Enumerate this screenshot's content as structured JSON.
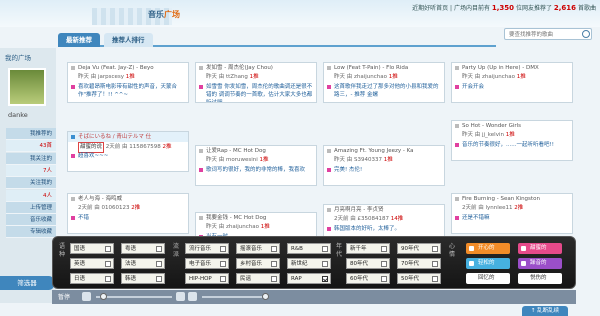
{
  "header": {
    "logo_main": "音乐",
    "logo_accent": "广场",
    "links": "近期好听首页 | 广场内目前有",
    "count_a": "1,350",
    "mid": "位网友推荐了",
    "count_b": "2,616",
    "tail": "首歌曲",
    "search_placeholder": "要查找推荐的歌曲"
  },
  "tabs": [
    "最新推荐",
    "推荐人排行"
  ],
  "sidebar": {
    "title": "我的广场",
    "username": "danke",
    "rows": [
      {
        "label": "我推荐的"
      },
      {
        "label": "43首",
        "num": true
      },
      {
        "label": "我关注的"
      },
      {
        "label": "7人",
        "num": true
      },
      {
        "label": "关注我的"
      },
      {
        "label": "4人",
        "num": true
      },
      {
        "label": "上传管理"
      },
      {
        "label": "音乐收藏"
      },
      {
        "label": "专辑收藏"
      }
    ],
    "filter_button": "筛选器"
  },
  "cards": [
    {
      "title": "Deja Vu (Feat. Jay-Z) - Beyo",
      "meta": "昨天 由 jarpscesy",
      "rank": "1推",
      "body": "喜欢碧昂斯电影带有甜性的声音，天蒙合作\"推荐了！!! ^^~"
    },
    {
      "title": "发如雪 - 周杰伦(Jay Chou)",
      "meta": "昨天 由 ttZhang",
      "rank": "1推",
      "body": "如雪雪 你发如雪，周杰伦的歌曲调还是很不错的 调调节奏的一首歌，估计大家大多也都听过吧"
    },
    {
      "title": "Low (Feat T-Pain) - Flo Rida",
      "meta": "昨天 由 zhaijunchao",
      "rank": "1推",
      "body": "这首歌伴我走过了那多对他的小县和我爱的路三，- 推荐 金螺"
    },
    {
      "title": "Party Up (Up in Here) - DMX",
      "meta": "昨天 由 zhaijunchao",
      "rank": "1推",
      "body": "开会开会"
    },
    {
      "title": "そばにいるね / 青山テルマ 仕",
      "meta": "2天前 由 115867598",
      "rank": "2推",
      "body": "超喜欢~~~",
      "highlight": "甜蜜的说",
      "blue": true
    },
    {
      "title": "让爱Rap - MC Hot Dog",
      "meta": "昨天 由 moruwesini",
      "rank": "1推",
      "body": "歌词写的很好，我的的非常的棒，我喜欢"
    },
    {
      "title": "Amazing Ft. Young Jeezy - Ka",
      "meta": "昨天 由 S3940337",
      "rank": "1推",
      "body": "完美! 杰伦!"
    },
    {
      "title": "So Hot - Wonder Girls",
      "meta": "昨天 由 jj_kelvin",
      "rank": "1推",
      "body": "音乐的节奏很好，......一起听听看吧!!"
    },
    {
      "title": "老人与海 - 海鸣威",
      "meta": "2天前 由 01060123",
      "rank": "2推",
      "body": "不错"
    },
    {
      "title": "我要金钱 - MC Hot Dog",
      "meta": "昨天 由 zhaijunchao",
      "rank": "1推",
      "body": "当有一时"
    },
    {
      "title": "月亮啊月亮 - 李贞贤",
      "meta": "2天前 由 £35084187",
      "rank": "14推",
      "body": "韩国版本的好听，太棒了。"
    },
    {
      "title": "Fire Burning - Sean Kingston",
      "meta": "2天前 由 lynnlee11",
      "rank": "2推",
      "body": "还是不错嘛"
    }
  ],
  "filter": {
    "lang_label": "语种",
    "lang": [
      {
        "label": "国语",
        "checked": false
      },
      {
        "label": "粤语",
        "checked": false
      },
      {
        "label": "英语",
        "checked": false
      },
      {
        "label": "法语",
        "checked": false
      },
      {
        "label": "日语",
        "checked": false
      },
      {
        "label": "韩语",
        "checked": false
      }
    ],
    "genre_label": "流派",
    "genre": [
      {
        "label": "流行音乐",
        "checked": false
      },
      {
        "label": "摇滚音乐",
        "checked": false
      },
      {
        "label": "R&B",
        "checked": false
      },
      {
        "label": "电子音乐",
        "checked": false
      },
      {
        "label": "乡村音乐",
        "checked": false
      },
      {
        "label": "新世纪",
        "checked": false
      },
      {
        "label": "HIP-HOP",
        "checked": false
      },
      {
        "label": "民谣",
        "checked": false
      },
      {
        "label": "RAP",
        "checked": true
      }
    ],
    "era_label": "年代",
    "era": [
      {
        "label": "新千年",
        "checked": false
      },
      {
        "label": "90年代",
        "checked": false
      },
      {
        "label": "80年代",
        "checked": false
      },
      {
        "label": "70年代",
        "checked": false
      },
      {
        "label": "60年代",
        "checked": false
      },
      {
        "label": "50年代",
        "checked": false
      }
    ],
    "mood_label": "心情",
    "mood": [
      {
        "label": "开心的",
        "color": "#f28c28"
      },
      {
        "label": "甜蜜的",
        "color": "#e64a8a"
      },
      {
        "label": "轻松的",
        "color": "#46b0e0"
      },
      {
        "label": "躁音的",
        "color": "#9b4fc9"
      },
      {
        "label": "回忆的",
        "color": "#ffffff"
      },
      {
        "label": "悦伤的",
        "color": "#ffffff"
      }
    ]
  },
  "player": {
    "pause_label": "暂停",
    "bottom_tab": "↑ 乱断乱续"
  }
}
